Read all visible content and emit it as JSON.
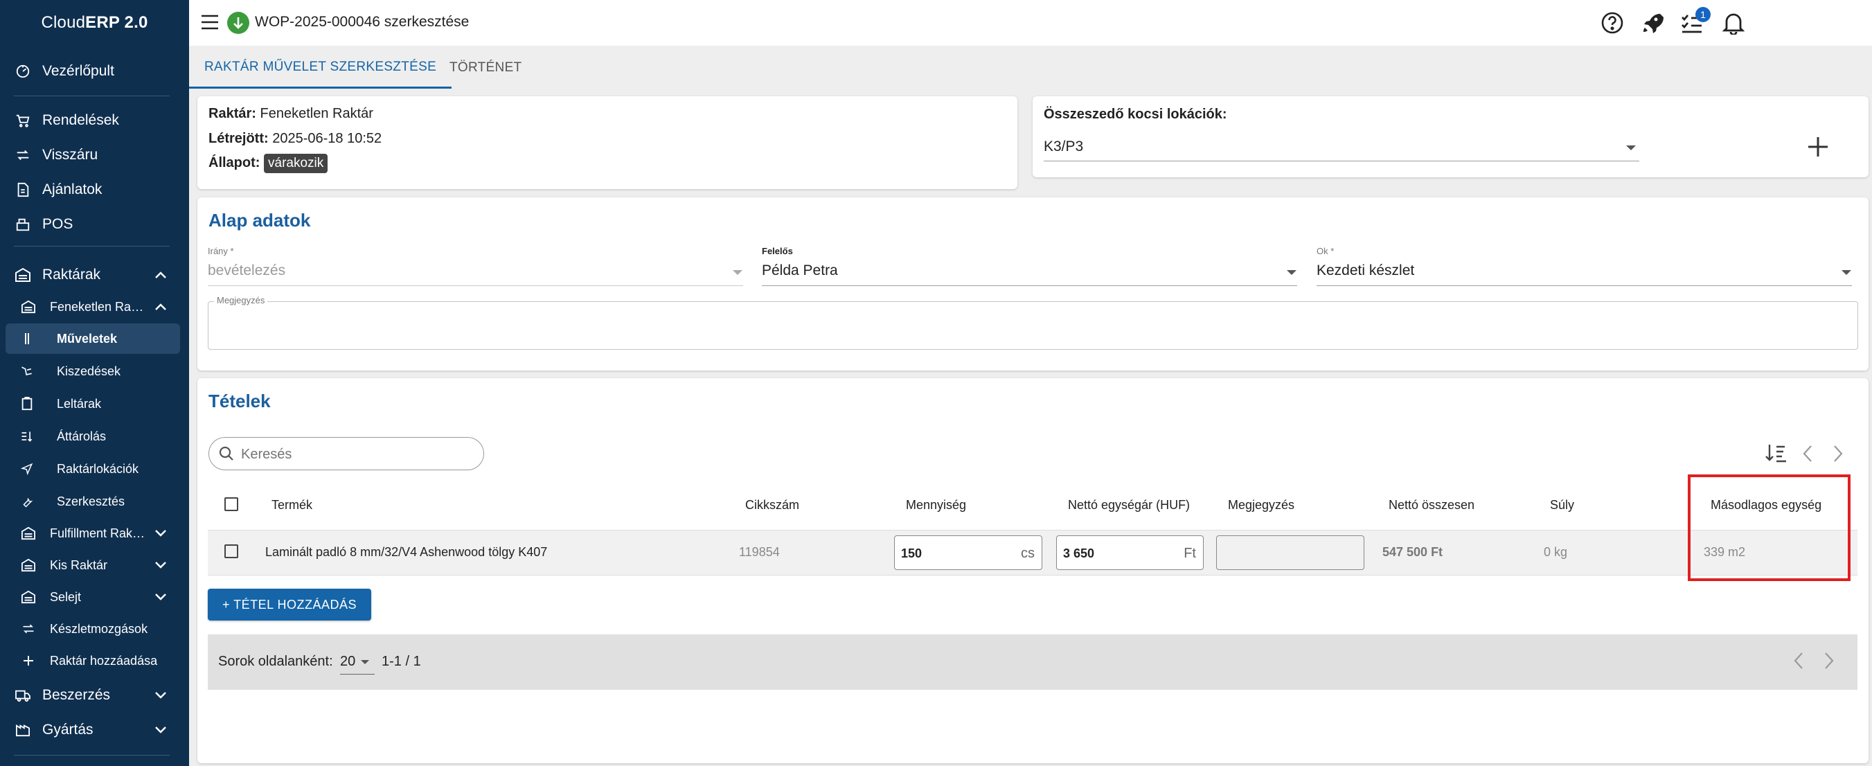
{
  "brand": {
    "prefix": "Cloud",
    "bold": "ERP 2.0"
  },
  "sidebar": {
    "items": [
      {
        "label": "Vezérlőpult",
        "icon": "dashboard-icon"
      },
      {
        "label": "Rendelések",
        "icon": "cart-icon"
      },
      {
        "label": "Visszáru",
        "icon": "swap-icon"
      },
      {
        "label": "Ajánlatok",
        "icon": "document-icon"
      },
      {
        "label": "POS",
        "icon": "register-icon"
      },
      {
        "label": "Raktárak",
        "icon": "warehouse-icon"
      },
      {
        "label": "Feneketlen Ra…",
        "icon": "warehouse-icon"
      },
      {
        "label": "Műveletek",
        "icon": "operations-icon"
      },
      {
        "label": "Kiszedések",
        "icon": "pick-icon"
      },
      {
        "label": "Leltárak",
        "icon": "clipboard-icon"
      },
      {
        "label": "Áttárolás",
        "icon": "transfer-icon"
      },
      {
        "label": "Raktárlokációk",
        "icon": "location-icon"
      },
      {
        "label": "Szerkesztés",
        "icon": "wrench-icon"
      },
      {
        "label": "Fulfillment Rak…",
        "icon": "warehouse-icon"
      },
      {
        "label": "Kis Raktár",
        "icon": "warehouse-icon"
      },
      {
        "label": "Selejt",
        "icon": "warehouse-icon"
      },
      {
        "label": "Készletmozgások",
        "icon": "swap-icon"
      },
      {
        "label": "Raktár hozzáadása",
        "icon": "plus-icon"
      },
      {
        "label": "Beszerzés",
        "icon": "truck-icon"
      },
      {
        "label": "Gyártás",
        "icon": "factory-icon"
      }
    ]
  },
  "header": {
    "title": "WOP-2025-000046 szerkesztése",
    "notification_count": "1"
  },
  "tabs": [
    {
      "label": "RAKTÁR MŰVELET SZERKESZTÉSE"
    },
    {
      "label": "TÖRTÉNET"
    }
  ],
  "info": {
    "warehouse_label": "Raktár:",
    "warehouse_value": "Feneketlen Raktár",
    "created_label": "Létrejött:",
    "created_value": "2025-06-18 10:52",
    "status_label": "Állapot:",
    "status_value": "várakozik"
  },
  "cart": {
    "title": "Összeszedő kocsi lokációk:",
    "value": "K3/P3"
  },
  "basic": {
    "title": "Alap adatok",
    "direction_label": "Irány *",
    "direction_value": "bevételezés",
    "responsible_label": "Felelős",
    "responsible_value": "Példa Petra",
    "reason_label": "Ok *",
    "reason_value": "Kezdeti készlet",
    "note_label": "Megjegyzés"
  },
  "items": {
    "title": "Tételek",
    "search_placeholder": "Keresés",
    "headers": [
      "Termék",
      "Cikkszám",
      "Mennyiség",
      "Nettó egységár (HUF)",
      "Megjegyzés",
      "Nettó összesen",
      "Súly",
      "Másodlagos egység"
    ],
    "rows": [
      {
        "product": "Laminált padló 8 mm/32/V4 Ashenwood tölgy K407",
        "sku": "119854",
        "qty": "150",
        "qty_unit": "cs",
        "price": "3 650",
        "price_unit": "Ft",
        "note": "",
        "total": "547 500 Ft",
        "weight": "0 kg",
        "secondary": "339 m2"
      }
    ],
    "add_button": "+ TÉTEL HOZZÁADÁS",
    "pagination": {
      "label": "Sorok oldalanként:",
      "per_page": "20",
      "range": "1-1 / 1"
    }
  },
  "colors": {
    "sidebar": "#0f2f4f",
    "accent": "#1565a8",
    "highlight": "#e02020"
  }
}
